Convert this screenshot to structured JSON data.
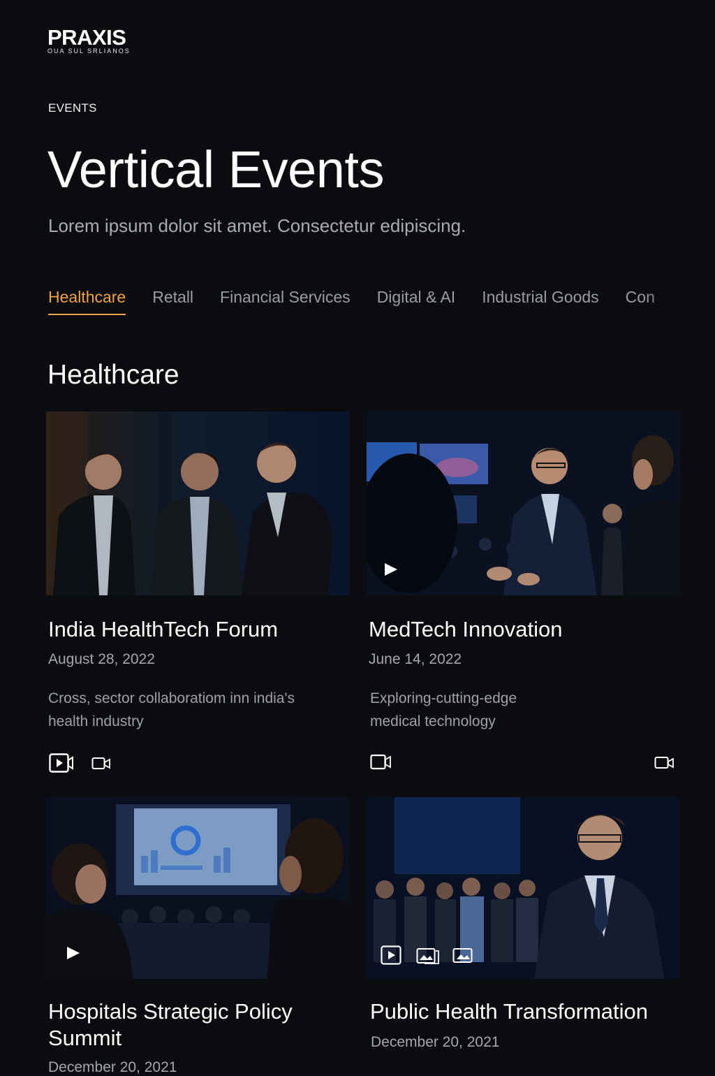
{
  "brand": {
    "name": "PRAXIS",
    "tagline": "OUA SUL SRLIANOS"
  },
  "page": {
    "eyebrow": "EVENTS",
    "title": "Vertical Events",
    "subtitle": "Lorem ipsum dolor sit amet. Consectetur edipiscing."
  },
  "tabs": [
    {
      "label": "Healthcare",
      "active": true
    },
    {
      "label": "Retall",
      "active": false
    },
    {
      "label": "Financial Services",
      "active": false
    },
    {
      "label": "Digital & AI",
      "active": false
    },
    {
      "label": "Industrial Goods",
      "active": false
    },
    {
      "label": "Con",
      "active": false
    }
  ],
  "section": {
    "title": "Healthcare"
  },
  "cards": [
    {
      "title": "India HealthTech Forum",
      "date": "August 28, 2022",
      "description": "Cross, sector collaboratiom inn india's health industry",
      "icons": [
        "video-play-icon",
        "video-camera-icon"
      ]
    },
    {
      "title": "MedTech Innovation",
      "date": "June 14, 2022",
      "description": "Exploring-cutting-edge medical technology",
      "icons": [
        "play-icon",
        "video-camera-icon",
        "video-camera-icon"
      ]
    },
    {
      "title": "Hospitals Strategic Policy Summit",
      "date": "December 20, 2021",
      "icons": [
        "play-icon"
      ]
    },
    {
      "title": "Public Health Transformation",
      "date": "December 20, 2021",
      "icons": [
        "play-icon",
        "gallery-icon",
        "image-icon"
      ]
    }
  ],
  "colors": {
    "background": "#0b0c0f",
    "accent": "#f0a24a",
    "text_primary": "#ffffff",
    "text_secondary": "#a4a7ad"
  }
}
